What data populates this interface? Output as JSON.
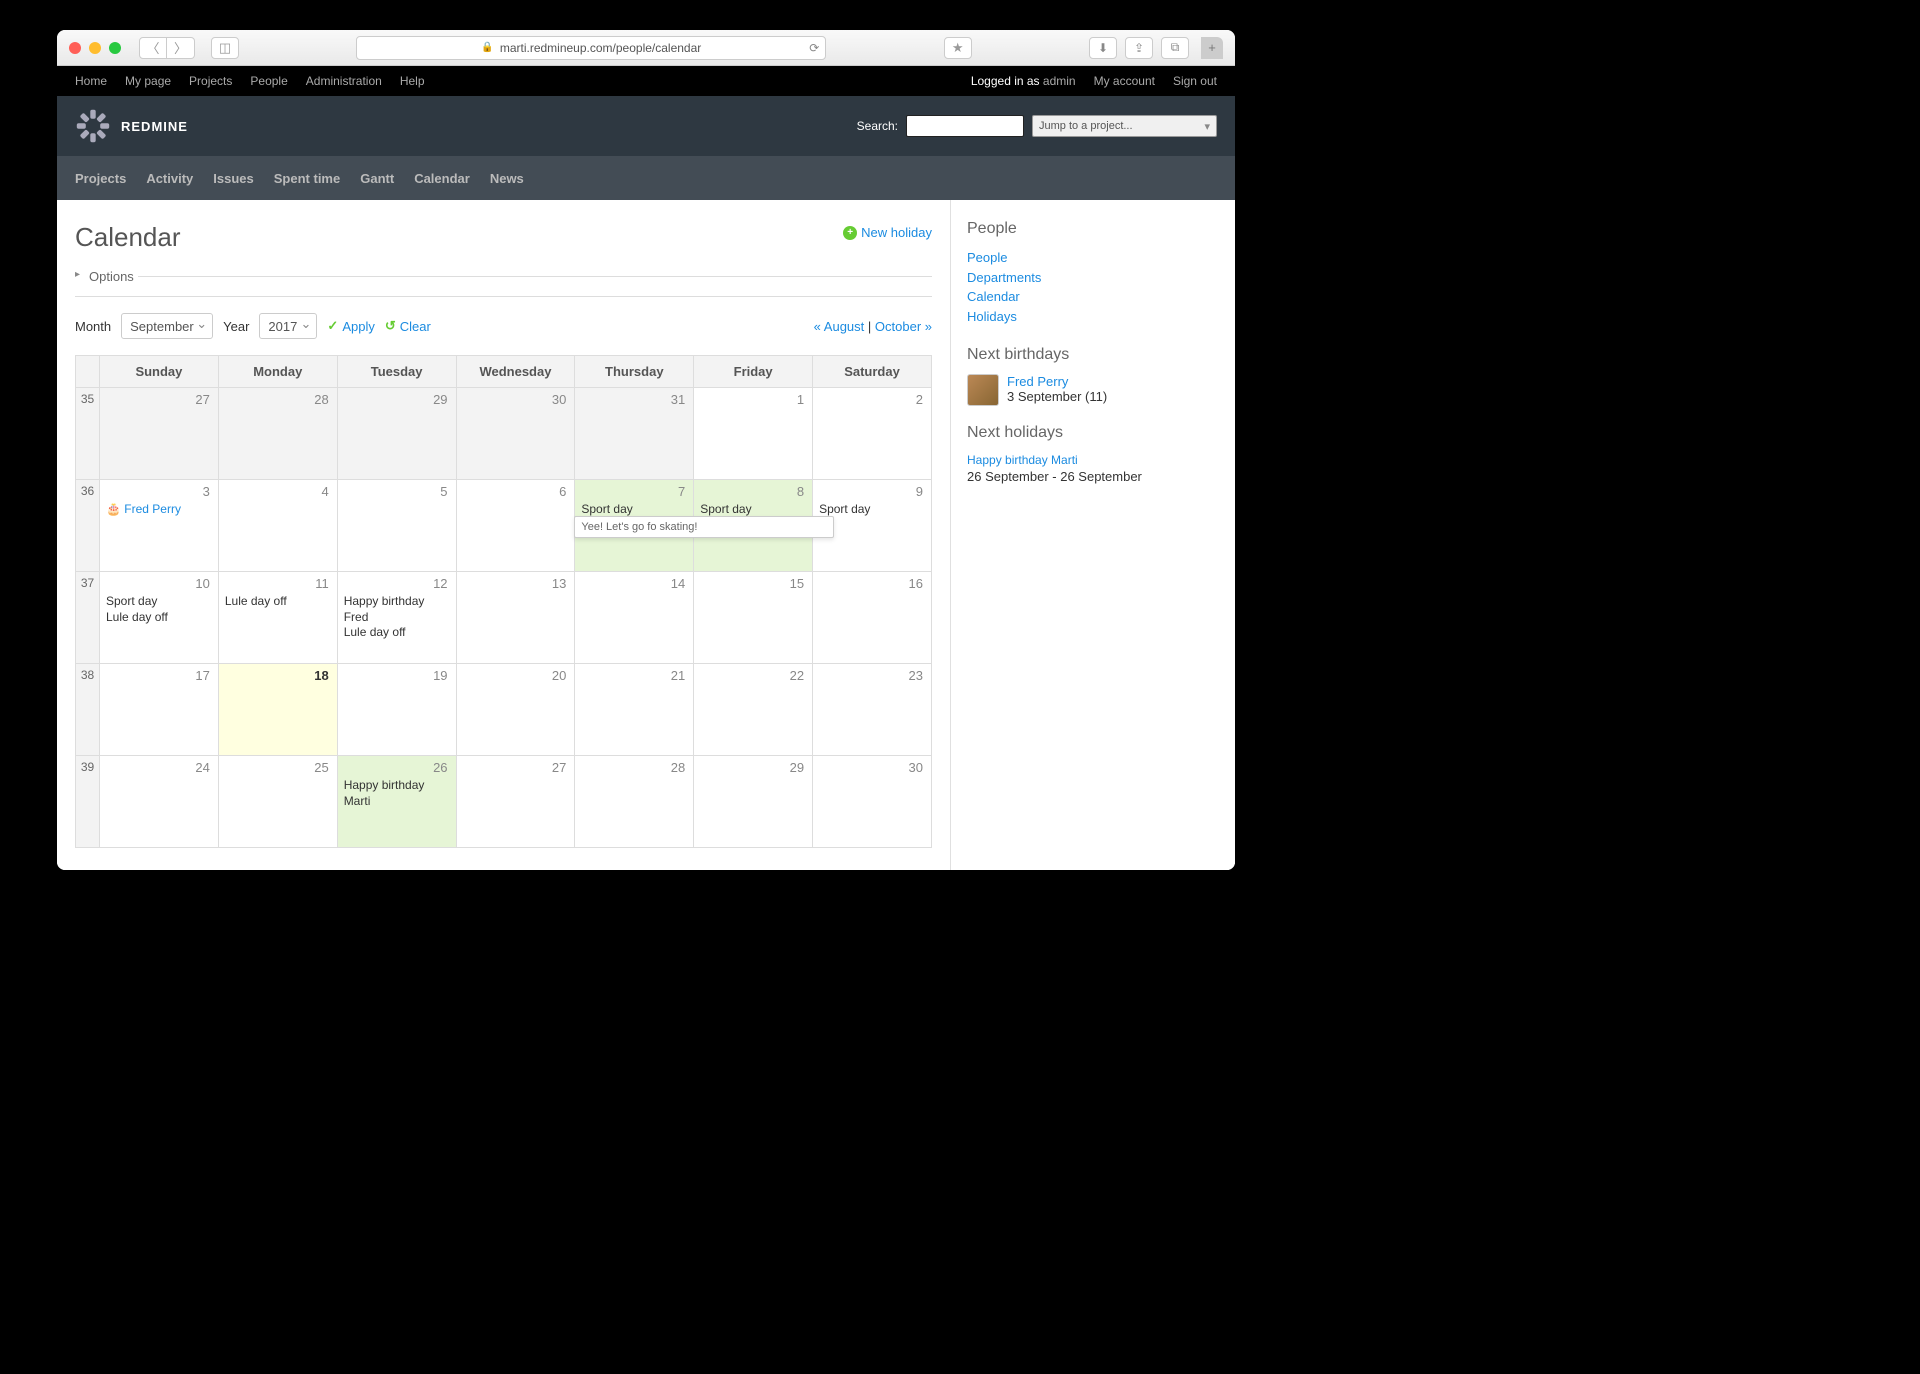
{
  "browser": {
    "url": "marti.redmineup.com/people/calendar"
  },
  "top_menu": {
    "items": [
      "Home",
      "My page",
      "Projects",
      "People",
      "Administration",
      "Help"
    ],
    "logged_in_as": "Logged in as",
    "user": "admin",
    "my_account": "My account",
    "sign_out": "Sign out"
  },
  "header": {
    "title": "REDMINE",
    "search_label": "Search:",
    "project_select": "Jump to a project..."
  },
  "main_menu": [
    "Projects",
    "Activity",
    "Issues",
    "Spent time",
    "Gantt",
    "Calendar",
    "News"
  ],
  "page": {
    "title": "Calendar",
    "new_holiday": "New holiday",
    "options": "Options",
    "month_label": "Month",
    "month_value": "September",
    "year_label": "Year",
    "year_value": "2017",
    "apply": "Apply",
    "clear": "Clear",
    "prev_month": "« August",
    "next_month": "October »"
  },
  "calendar": {
    "headers": [
      "Sunday",
      "Monday",
      "Tuesday",
      "Wednesday",
      "Thursday",
      "Friday",
      "Saturday"
    ],
    "weeks": [
      {
        "wn": "35",
        "days": [
          {
            "n": "27",
            "other": true
          },
          {
            "n": "28",
            "other": true
          },
          {
            "n": "29",
            "other": true
          },
          {
            "n": "30",
            "other": true
          },
          {
            "n": "31",
            "other": true
          },
          {
            "n": "1"
          },
          {
            "n": "2"
          }
        ]
      },
      {
        "wn": "36",
        "days": [
          {
            "n": "3",
            "body_link": "Fred Perry",
            "bday": true
          },
          {
            "n": "4"
          },
          {
            "n": "5"
          },
          {
            "n": "6"
          },
          {
            "n": "7",
            "holiday": true,
            "body": "Sport day",
            "tooltip": "Yee! Let's go fo skating!"
          },
          {
            "n": "8",
            "holiday": true,
            "body": "Sport day"
          },
          {
            "n": "9",
            "body": "Sport day"
          }
        ]
      },
      {
        "wn": "37",
        "days": [
          {
            "n": "10",
            "body": "Sport day\nLule day off"
          },
          {
            "n": "11",
            "body": "Lule day off"
          },
          {
            "n": "12",
            "body": "Happy birthday Fred\nLule day off"
          },
          {
            "n": "13"
          },
          {
            "n": "14"
          },
          {
            "n": "15"
          },
          {
            "n": "16"
          }
        ]
      },
      {
        "wn": "38",
        "days": [
          {
            "n": "17"
          },
          {
            "n": "18",
            "today": true
          },
          {
            "n": "19"
          },
          {
            "n": "20"
          },
          {
            "n": "21"
          },
          {
            "n": "22"
          },
          {
            "n": "23"
          }
        ]
      },
      {
        "wn": "39",
        "days": [
          {
            "n": "24"
          },
          {
            "n": "25"
          },
          {
            "n": "26",
            "holiday": true,
            "body": "Happy birthday Marti"
          },
          {
            "n": "27"
          },
          {
            "n": "28"
          },
          {
            "n": "29"
          },
          {
            "n": "30"
          }
        ]
      }
    ]
  },
  "sidebar": {
    "people_heading": "People",
    "people_links": [
      "People",
      "Departments",
      "Calendar",
      "Holidays"
    ],
    "birthdays_heading": "Next birthdays",
    "birthday": {
      "name": "Fred Perry",
      "date": "3 September (11)"
    },
    "holidays_heading": "Next holidays",
    "holiday": {
      "name": "Happy birthday Marti",
      "date": "26 September - 26 September"
    }
  }
}
